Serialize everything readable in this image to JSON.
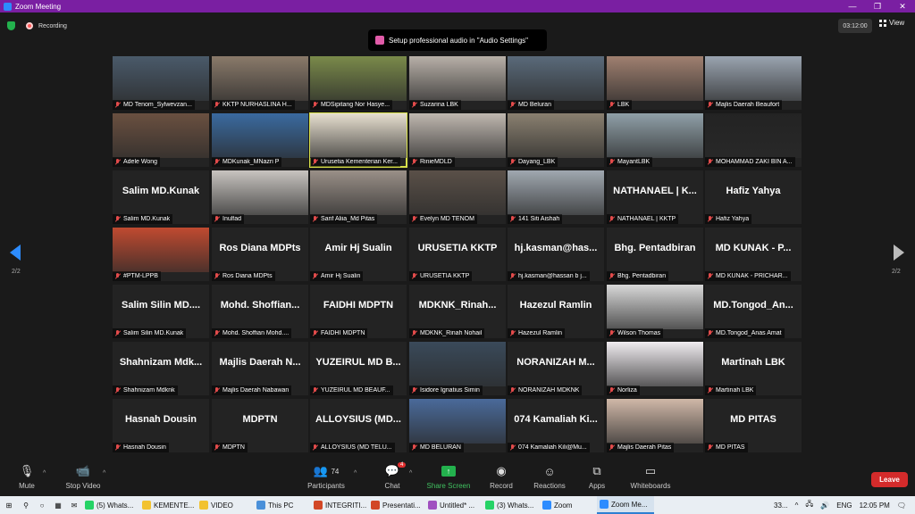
{
  "window": {
    "title": "Zoom Meeting",
    "controls": [
      "—",
      "❐",
      "✕"
    ]
  },
  "infobar": {
    "recording_label": "Recording",
    "timer": "03:12:00",
    "view_label": "View"
  },
  "toast": {
    "text": "Setup professional audio in  \"Audio Settings\""
  },
  "pager": {
    "left": "2/2",
    "right": "2/2"
  },
  "colors": {
    "accent": "#2d8cff",
    "titlebar": "#7a1fa2",
    "leave": "#d42b2b",
    "share": "#23b14d",
    "active_border": "#d8e04a"
  },
  "tiles": [
    {
      "big": "",
      "label": "MD Tenom_Sylwevzan...",
      "video": "#4a5a6a"
    },
    {
      "big": "",
      "label": "KKTP NURHASLINA H...",
      "video": "#8a7a6a"
    },
    {
      "big": "",
      "label": "MDSipitang Nor Hasye...",
      "video": "#7a8a4a"
    },
    {
      "big": "",
      "label": "Suzarina LBK",
      "video": "#b8b0a8"
    },
    {
      "big": "",
      "label": "MD Beluran",
      "video": "#5a6a7a"
    },
    {
      "big": "",
      "label": "LBK",
      "video": "#a08070"
    },
    {
      "big": "",
      "label": "Majlis Daerah Beaufort",
      "video": "#9aa4b0"
    },
    {
      "big": "",
      "label": "Adele Wong",
      "video": "#6a5040"
    },
    {
      "big": "",
      "label": "MDKunak_MNazri P",
      "video": "#3a6aa0"
    },
    {
      "big": "",
      "label": "Urusetia Kementerian Ker...",
      "video": "#e8e0d0",
      "active": true
    },
    {
      "big": "",
      "label": "RinieMDLD",
      "video": "#c0b8b0"
    },
    {
      "big": "",
      "label": "Dayang_LBK",
      "video": "#8a8070"
    },
    {
      "big": "",
      "label": "MayantLBK",
      "video": "#90a0a8"
    },
    {
      "big": "",
      "label": "MOHAMMAD ZAKI BIN A...",
      "video": "#232323"
    },
    {
      "big": "Salim MD.Kunak",
      "label": "Salim MD.Kunak"
    },
    {
      "big": "",
      "label": "Inulfad",
      "video": "#c8c4c0"
    },
    {
      "big": "",
      "label": "Sarif Aliia_Md Pitas",
      "video": "#9a9088"
    },
    {
      "big": "",
      "label": "Evelyn MD TENOM",
      "video": "#5a5048"
    },
    {
      "big": "",
      "label": "141 Siti Aishah",
      "video": "#a0a8b0"
    },
    {
      "big": "NATHANAEL | K...",
      "label": "NATHANAEL | KKTP"
    },
    {
      "big": "Hafiz Yahya",
      "label": "Hafiz Yahya"
    },
    {
      "big": "",
      "label": "#PTM-LPPB",
      "video": "#c04a30"
    },
    {
      "big": "Ros Diana MDPts",
      "label": "Ros Diana MDPts"
    },
    {
      "big": "Amir Hj Sualin",
      "label": "Amir Hj Sualin"
    },
    {
      "big": "URUSETIA KKTP",
      "label": "URUSETIA KKTP"
    },
    {
      "big": "hj.kasman@has...",
      "label": "hj.kasman@hassan b j..."
    },
    {
      "big": "Bhg. Pentadbiran",
      "label": "Bhg. Pentadbiran"
    },
    {
      "big": "MD KUNAK - P...",
      "label": "MD KUNAK - PRICHAR..."
    },
    {
      "big": "Salim Silin MD....",
      "label": "Salim Silin MD.Kunak"
    },
    {
      "big": "Mohd. Shoffian...",
      "label": "Mohd. Shoffian Mohd...."
    },
    {
      "big": "FAIDHI MDPTN",
      "label": "FAIDHI MDPTN"
    },
    {
      "big": "MDKNK_Rinah...",
      "label": "MDKNK_Rinah Nohail"
    },
    {
      "big": "Hazezul Ramlin",
      "label": "Hazezul Ramlin"
    },
    {
      "big": "",
      "label": "Wilson Thomas",
      "video": "#d8d8d8"
    },
    {
      "big": "MD.Tongod_An...",
      "label": "MD.Tongod_Anas Amat"
    },
    {
      "big": "Shahnizam Mdk...",
      "label": "Shahnizam Mdknk"
    },
    {
      "big": "Majlis Daerah N...",
      "label": "Majlis Daerah Nabawan"
    },
    {
      "big": "YUZEIRUL MD B...",
      "label": "YUZEIRUL MD BEAUF..."
    },
    {
      "big": "",
      "label": "Isidore Ignatius Simin",
      "video": "#3a4a5a"
    },
    {
      "big": "NORANIZAH M...",
      "label": "NORANIZAH MDKNK"
    },
    {
      "big": "",
      "label": "Norliza",
      "video": "#f0ecf0"
    },
    {
      "big": "Martinah LBK",
      "label": "Martinah LBK"
    },
    {
      "big": "Hasnah Dousin",
      "label": "Hasnah Dousin"
    },
    {
      "big": "MDPTN",
      "label": "MDPTN"
    },
    {
      "big": "ALLOYSIUS (MD...",
      "label": "ALLOYSIUS (MD TELU..."
    },
    {
      "big": "",
      "label": "MD BELURAN",
      "video": "#4a6a9a"
    },
    {
      "big": "074 Kamaliah Ki...",
      "label": "074 Kamaliah Kili@Mu..."
    },
    {
      "big": "",
      "label": "Majlis Daerah Pitas",
      "video": "#d0b8a8"
    },
    {
      "big": "MD PITAS",
      "label": "MD PITAS"
    }
  ],
  "toolbar": {
    "mute": "Mute",
    "stop_video": "Stop Video",
    "participants": "Participants",
    "participants_count": "74",
    "chat": "Chat",
    "chat_badge": "4",
    "share": "Share Screen",
    "record": "Record",
    "reactions": "Reactions",
    "apps": "Apps",
    "whiteboards": "Whiteboards",
    "leave": "Leave"
  },
  "taskbar": {
    "items": [
      {
        "label": "(5) Whats...",
        "color": "#25d366"
      },
      {
        "label": "KEMENTE...",
        "color": "#f2c230"
      },
      {
        "label": "VIDEO",
        "color": "#f2c230"
      },
      {
        "label": "This PC",
        "color": "#4a90d9"
      },
      {
        "label": "INTEGRITI...",
        "color": "#d24726"
      },
      {
        "label": "Presentati...",
        "color": "#d24726"
      },
      {
        "label": "Untitled* ...",
        "color": "#a050c0"
      },
      {
        "label": "(3) Whats...",
        "color": "#25d366"
      },
      {
        "label": "Zoom",
        "color": "#2d8cff"
      },
      {
        "label": "Zoom Me...",
        "color": "#2d8cff",
        "active": true
      }
    ],
    "weather": "33...",
    "lang": "ENG",
    "time": "12:05 PM"
  }
}
